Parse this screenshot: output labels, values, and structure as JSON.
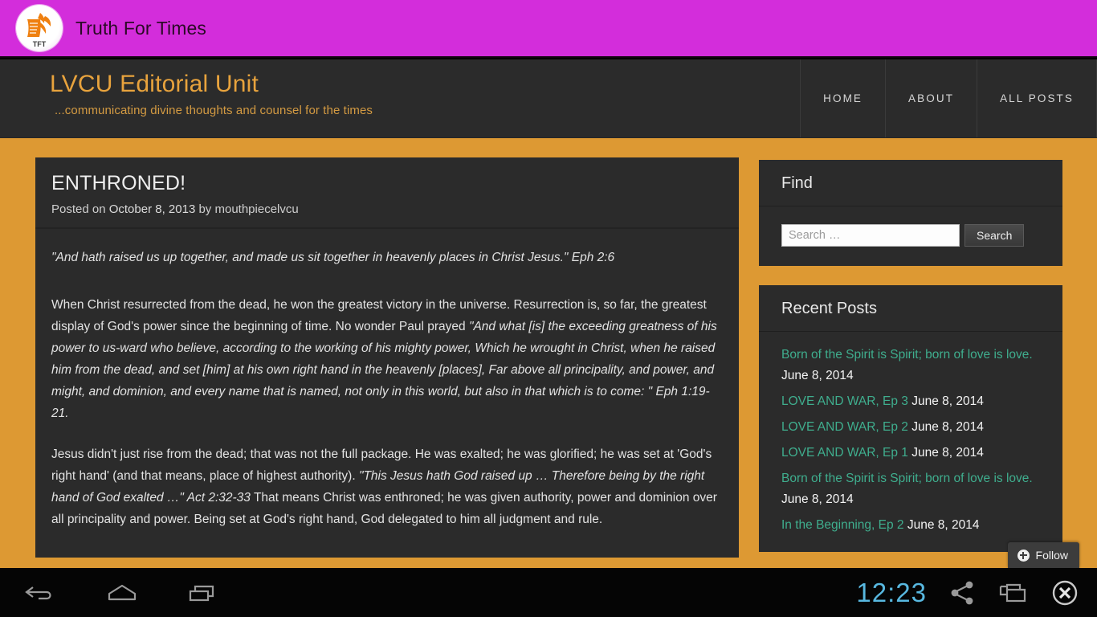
{
  "app": {
    "title": "Truth For Times",
    "logo_icon": "tft-scroll-wing-logo",
    "logo_text": "TFT",
    "bar_color": "#d32ddb"
  },
  "site": {
    "brand_title": "LVCU Editorial Unit",
    "brand_tagline": "...communicating divine thoughts and counsel for the times",
    "accent_color": "#dd9933",
    "nav": [
      {
        "label": "HOME"
      },
      {
        "label": "ABOUT"
      },
      {
        "label": "ALL POSTS"
      }
    ]
  },
  "post": {
    "title": "ENTHRONED!",
    "meta_prefix": "Posted on ",
    "date": "October 8, 2013",
    "meta_by": " by ",
    "author": "mouthpiecelvcu",
    "verse_quote": "\"And hath raised us up together, and made us sit together in heavenly places in Christ Jesus.\" Eph 2:6",
    "para1_a": "When Christ resurrected from the dead, he won the greatest victory in the universe. Resurrection is, so far, the greatest display of God's power since the beginning of time. No wonder Paul prayed ",
    "para1_quote": "\"And what [is] the exceeding greatness of his power to us-ward who believe, according to the working of his mighty power, Which he wrought in Christ, when he raised him from the dead, and set [him] at his own right hand in the heavenly [places], Far above all principality, and power, and might, and dominion, and every name that is named, not only in this world, but also in that which is to come: \" Eph 1:19-21.",
    "para2_a": "Jesus didn't just rise from the dead; that was not the full package. He was exalted; he was glorified; he was set at 'God's right hand' (and that means, place of highest authority). ",
    "para2_quote": "\"This Jesus hath God raised up … Therefore being by the right hand of God exalted …\" Act 2:32-33",
    "para2_b": " That means Christ was enthroned; he was given authority, power and dominion over all principality and power. Being set at God's right hand, God delegated to him all judgment and rule."
  },
  "sidebar": {
    "find": {
      "title": "Find",
      "search_value": "",
      "search_placeholder": "Search …",
      "submit_label": "Search"
    },
    "recent": {
      "title": "Recent Posts",
      "items": [
        {
          "link": "Born of the Spirit is Spirit; born of love is love.",
          "date": "June 8, 2014"
        },
        {
          "link": "LOVE AND WAR, Ep 3",
          "date": "June 8, 2014"
        },
        {
          "link": "LOVE AND WAR, Ep 2",
          "date": "June 8, 2014"
        },
        {
          "link": "LOVE AND WAR, Ep 1",
          "date": "June 8, 2014"
        },
        {
          "link": "Born of the Spirit is Spirit; born of love is love.",
          "date": "June 8, 2014"
        },
        {
          "link": "In the Beginning, Ep 2",
          "date": "June 8, 2014"
        }
      ],
      "link_color": "#3fae8e"
    },
    "follow_label": "Follow"
  },
  "system_bar": {
    "clock": "12:23",
    "clock_color": "#58b8e0",
    "icons": [
      "back-icon",
      "home-icon",
      "recent-apps-icon",
      "share-icon",
      "window-icon",
      "close-icon"
    ]
  }
}
